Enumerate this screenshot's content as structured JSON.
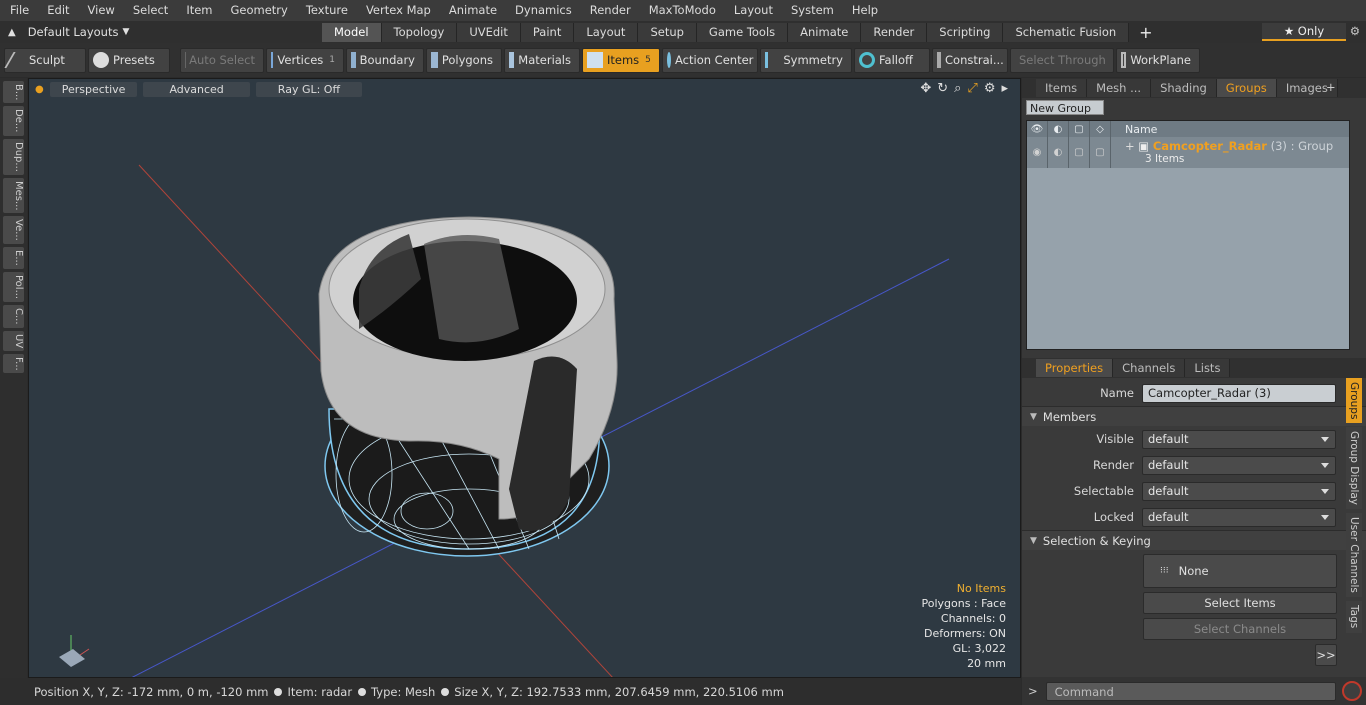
{
  "menu": [
    "File",
    "Edit",
    "View",
    "Select",
    "Item",
    "Geometry",
    "Texture",
    "Vertex Map",
    "Animate",
    "Dynamics",
    "Render",
    "MaxToModo",
    "Layout",
    "System",
    "Help"
  ],
  "layouts_label": "Default Layouts",
  "main_tabs": [
    {
      "label": "Model",
      "active": true
    },
    {
      "label": "Topology"
    },
    {
      "label": "UVEdit"
    },
    {
      "label": "Paint"
    },
    {
      "label": "Layout"
    },
    {
      "label": "Setup"
    },
    {
      "label": "Game Tools"
    },
    {
      "label": "Animate"
    },
    {
      "label": "Render"
    },
    {
      "label": "Scripting"
    },
    {
      "label": "Schematic Fusion"
    }
  ],
  "add_tab": "+",
  "only_label": "★ Only",
  "toolbar": {
    "sculpt": "Sculpt",
    "presets": "Presets",
    "auto_select": "Auto Select",
    "vertices": "Vertices",
    "vertices_count": "1",
    "boundary": "Boundary",
    "polygons": "Polygons",
    "materials": "Materials",
    "items": "Items",
    "items_count": "5",
    "action_center": "Action Center",
    "symmetry": "Symmetry",
    "falloff": "Falloff",
    "constraints": "Constrai...",
    "select_through": "Select Through",
    "workplane": "WorkPlane"
  },
  "left_tabs": [
    "B...",
    "De...",
    "Dup...",
    "Mes...",
    "Ve...",
    "E...",
    "Pol...",
    "C...",
    "UV",
    "F..."
  ],
  "viewport": {
    "perspective": "Perspective",
    "advanced": "Advanced",
    "raygl": "Ray GL: Off",
    "stats": {
      "no_items": "No Items",
      "polygons": "Polygons : Face",
      "channels": "Channels: 0",
      "deformers": "Deformers: ON",
      "gl": "GL: 3,022",
      "scale": "20 mm"
    }
  },
  "status": {
    "position": "Position X, Y, Z:  -172 mm, 0 m, -120 mm",
    "item": "Item:  radar",
    "type": "Type:  Mesh",
    "size": "Size X, Y, Z:   192.7533 mm, 207.6459 mm, 220.5106 mm"
  },
  "panel_tabs": [
    {
      "label": "Items"
    },
    {
      "label": "Mesh ..."
    },
    {
      "label": "Shading"
    },
    {
      "label": "Groups",
      "active": true
    },
    {
      "label": "Images"
    }
  ],
  "groups": {
    "new_group": "New Group",
    "column_name": "Name",
    "row": {
      "name": "Camcopter_Radar",
      "count": "(3)",
      "kind": ": Group",
      "sub": "3 Items"
    }
  },
  "prop_tabs": [
    {
      "label": "Properties",
      "active": true
    },
    {
      "label": "Channels"
    },
    {
      "label": "Lists"
    }
  ],
  "properties": {
    "name_label": "Name",
    "name_value": "Camcopter_Radar (3)",
    "members": "Members",
    "visible_label": "Visible",
    "visible": "default",
    "render_label": "Render",
    "render": "default",
    "selectable_label": "Selectable",
    "selectable": "default",
    "locked_label": "Locked",
    "locked": "default",
    "sel_keying": "Selection & Keying",
    "none": "None",
    "select_items": "Select Items",
    "select_channels": "Select Channels",
    "more": ">>"
  },
  "side_tabs": [
    "Groups",
    "Group Display",
    "User Channels",
    "Tags"
  ],
  "command_placeholder": "Command",
  "colors": {
    "accent": "#e8a020",
    "viewport_bg": "#2e3942",
    "groups_bg": "#96a2ab"
  }
}
